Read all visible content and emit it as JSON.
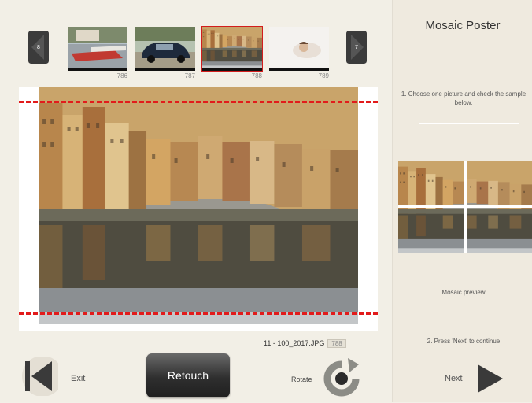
{
  "thumbnails": {
    "prev_page": "8",
    "next_page": "7",
    "items": [
      {
        "number": "786",
        "selected": false
      },
      {
        "number": "787",
        "selected": false
      },
      {
        "number": "788",
        "selected": true
      },
      {
        "number": "789",
        "selected": false
      }
    ]
  },
  "preview": {
    "filename": "11 - 100_2017.JPG",
    "photo_number": "788"
  },
  "controls": {
    "exit_label": "Exit",
    "retouch_label": "Retouch",
    "rotate_label": "Rotate"
  },
  "side_panel": {
    "title": "Mosaic Poster",
    "step1": "1. Choose one picture and check the sample below.",
    "mosaic_caption": "Mosaic preview",
    "step2": "2. Press 'Next' to continue",
    "next_label": "Next"
  },
  "colors": {
    "accent_red": "#d21d1d",
    "crop_line": "#e21b1b",
    "button_dark": "#2f2f2f"
  }
}
